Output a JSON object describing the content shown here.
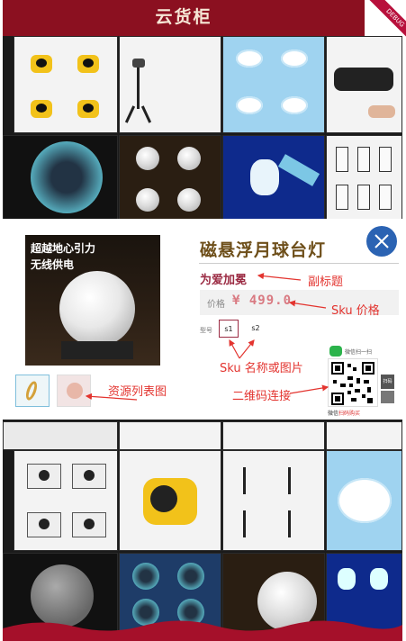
{
  "header": {
    "title": "云货柜",
    "debug_badge": "DEBUG"
  },
  "popup": {
    "product_image": {
      "headline_1": "超越地心引力",
      "headline_2": "无线供电"
    },
    "product_title": "磁悬浮月球台灯",
    "subtitle": "为爱加冕",
    "price_label": "价格",
    "price_value": "¥ 499.0",
    "sku_label": "型号",
    "sku_options": [
      "s1",
      "s2"
    ],
    "wechat": {
      "label": "微信扫一扫",
      "side_button": "扫码",
      "footer_prefix": "微信",
      "footer_highlight": "扫码购买"
    }
  },
  "annotations": {
    "subtitle": "副标题",
    "sku_price": "Sku 价格",
    "sku_name": "Sku 名称或图片",
    "resource_list": "资源列表图",
    "qr_link": "二维码连接"
  },
  "colors": {
    "header_bg": "#8b1020",
    "title_brown": "#6e4f1a",
    "subtitle_red": "#9b2b43",
    "price_pink": "#d97a82",
    "close_blue": "#2b63b3",
    "annotation_red": "#e3342f"
  },
  "icons": {
    "close": "close-icon",
    "wechat": "wechat-icon",
    "qr": "qr-code-icon"
  }
}
